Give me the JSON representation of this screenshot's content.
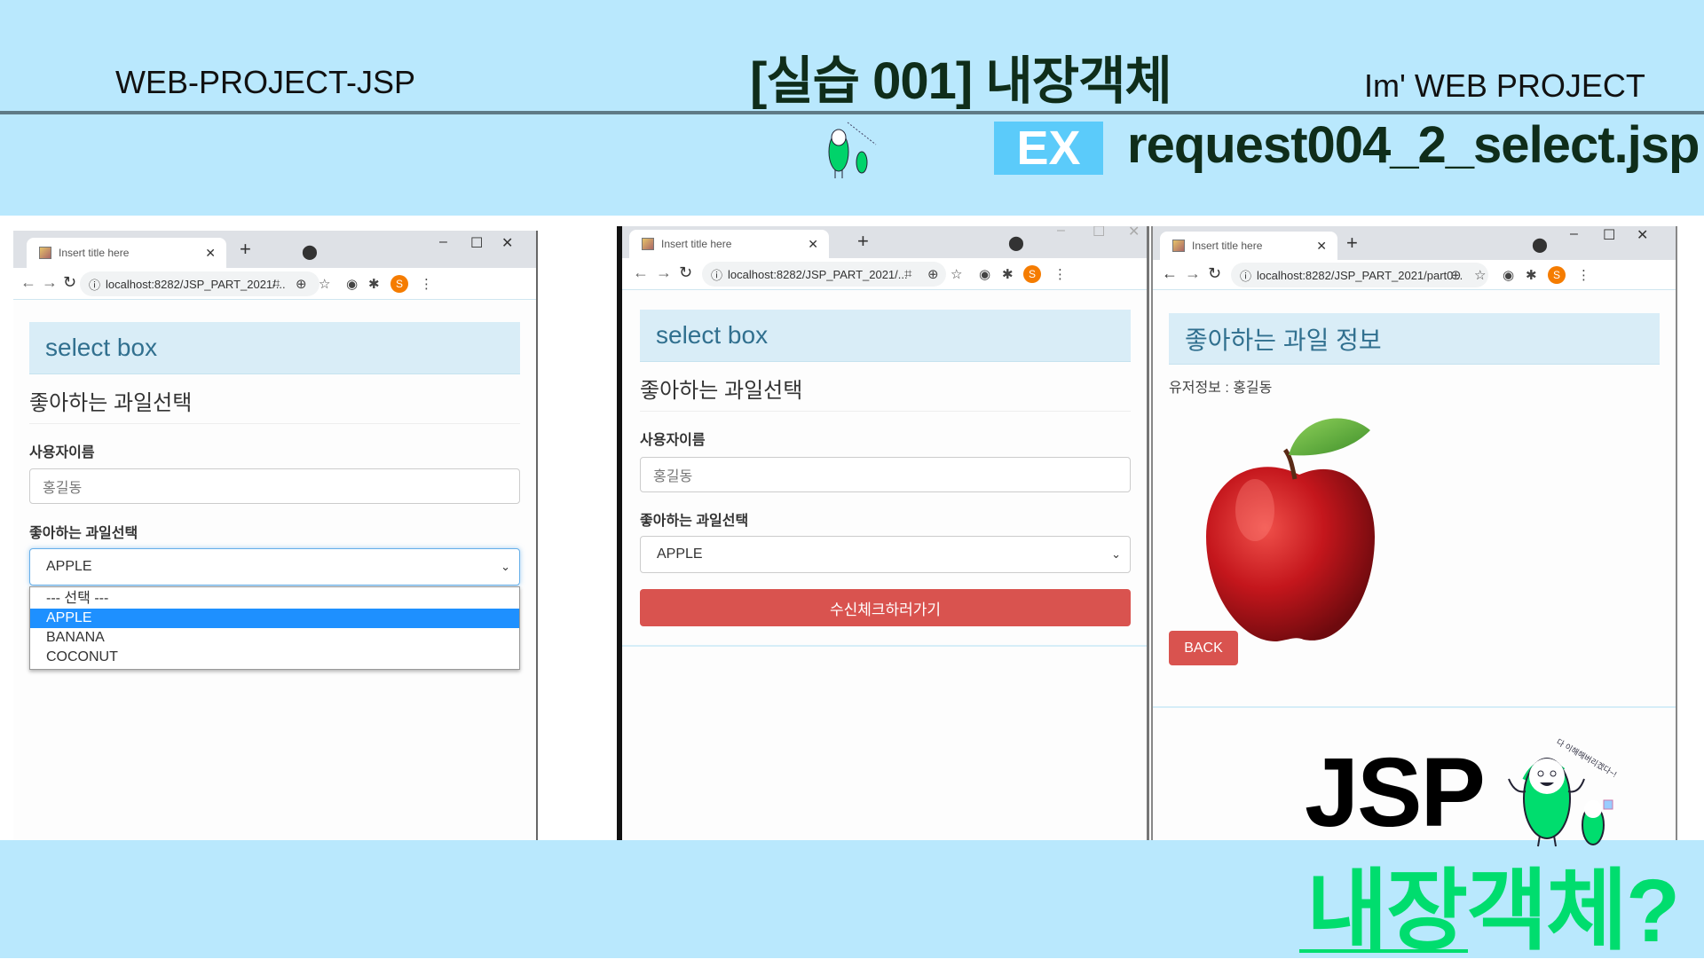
{
  "header": {
    "left": "WEB-PROJECT-JSP",
    "title": "[실습 001] 내장객체",
    "right": "Im' WEB PROJECT",
    "ex_badge": "EX",
    "filename": "request004_2_select.jsp",
    "ex_color": "#5bcbfa",
    "band_color": "#b9e8fd"
  },
  "browser": {
    "tab_title": "Insert title here",
    "avatar_letter": "S",
    "url_short": "localhost:8282/JSP_PART_2021/...",
    "url_result": "localhost:8282/JSP_PART_2021/part0..."
  },
  "form_page": {
    "jumbotron": "select box",
    "heading": "좋아하는 과일선택",
    "name_label": "사용자이름",
    "name_placeholder": "홍길동",
    "fruit_label": "좋아하는 과일선택",
    "selected": "APPLE",
    "options": [
      "--- 선택 ---",
      "APPLE",
      "BANANA",
      "COCONUT"
    ],
    "submit": "수신체크하러가기"
  },
  "result_page": {
    "jumbotron": "좋아하는 과일 정보",
    "user_info": "유저정보 : 홍길동",
    "image": "apple",
    "back": "BACK"
  },
  "promo": {
    "jsp": "JSP",
    "title": "내장객체?",
    "mascot_text": "JSP 다 이해해버리겠다~!",
    "accent": "#00dd6e"
  }
}
